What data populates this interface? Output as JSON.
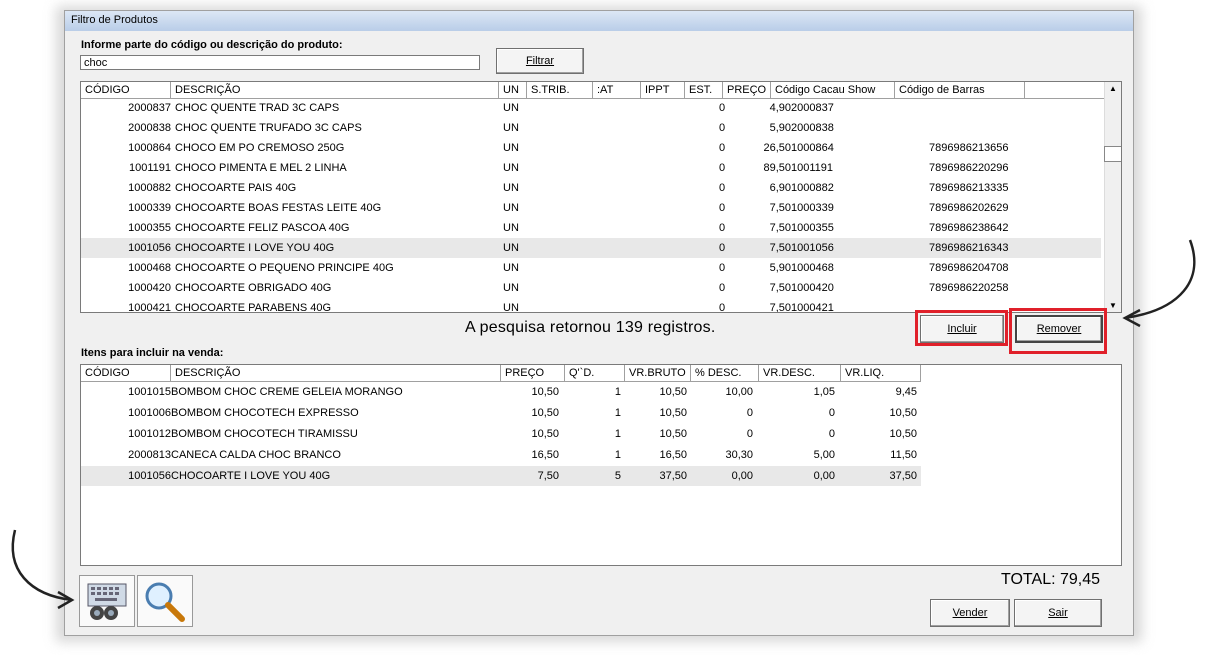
{
  "window": {
    "title": "Filtro de Produtos"
  },
  "search": {
    "prompt": "Informe parte do código ou descrição do produto:",
    "value": "choc",
    "filter_label": "Filtrar"
  },
  "products": {
    "columns": [
      "CÓDIGO",
      "DESCRIÇÃO",
      "UN",
      "S.TRIB.",
      ":AT",
      "IPPT",
      "EST.",
      "PREÇO",
      "Código Cacau Show",
      "Código de Barras"
    ],
    "rows": [
      {
        "code": "2000837",
        "desc": "CHOC QUENTE TRAD 3C CAPS",
        "un": "UN",
        "est": "0",
        "preco": "4,90",
        "cacau": "2000837",
        "barras": ""
      },
      {
        "code": "2000838",
        "desc": "CHOC QUENTE TRUFADO 3C CAPS",
        "un": "UN",
        "est": "0",
        "preco": "5,90",
        "cacau": "2000838",
        "barras": ""
      },
      {
        "code": "1000864",
        "desc": "CHOCO EM PO CREMOSO 250G",
        "un": "UN",
        "est": "0",
        "preco": "26,50",
        "cacau": "1000864",
        "barras": "7896986213656"
      },
      {
        "code": "1001191",
        "desc": "CHOCO PIMENTA E MEL 2 LINHA",
        "un": "UN",
        "est": "0",
        "preco": "89,50",
        "cacau": "1001191",
        "barras": "7896986220296"
      },
      {
        "code": "1000882",
        "desc": "CHOCOARTE  PAIS 40G",
        "un": "UN",
        "est": "0",
        "preco": "6,90",
        "cacau": "1000882",
        "barras": "7896986213335"
      },
      {
        "code": "1000339",
        "desc": "CHOCOARTE BOAS FESTAS LEITE 40G",
        "un": "UN",
        "est": "0",
        "preco": "7,50",
        "cacau": "1000339",
        "barras": "7896986202629"
      },
      {
        "code": "1000355",
        "desc": "CHOCOARTE FELIZ PASCOA 40G",
        "un": "UN",
        "est": "0",
        "preco": "7,50",
        "cacau": "1000355",
        "barras": "7896986238642"
      },
      {
        "code": "1001056",
        "desc": "CHOCOARTE I LOVE YOU 40G",
        "un": "UN",
        "est": "0",
        "preco": "7,50",
        "cacau": "1001056",
        "barras": "7896986216343"
      },
      {
        "code": "1000468",
        "desc": "CHOCOARTE O PEQUENO PRINCIPE 40G",
        "un": "UN",
        "est": "0",
        "preco": "5,90",
        "cacau": "1000468",
        "barras": "7896986204708"
      },
      {
        "code": "1000420",
        "desc": "CHOCOARTE OBRIGADO 40G",
        "un": "UN",
        "est": "0",
        "preco": "7,50",
        "cacau": "1000420",
        "barras": "7896986220258"
      },
      {
        "code": "1000421",
        "desc": "CHOCOARTE PARABENS 40G",
        "un": "UN",
        "est": "0",
        "preco": "7,50",
        "cacau": "1000421",
        "barras": ""
      }
    ],
    "selected_index": 7
  },
  "status_text": "A pesquisa retornou 139 registros.",
  "actions": {
    "incluir": "Incluir",
    "remover": "Remover"
  },
  "items": {
    "label": "Itens para incluir na venda:",
    "columns": [
      "CÓDIGO",
      "DESCRIÇÃO",
      "PREÇO",
      "Q'`D.",
      "VR.BRUTO",
      "% DESC.",
      "VR.DESC.",
      "VR.LIQ."
    ],
    "rows": [
      {
        "code": "1001015",
        "desc": "BOMBOM CHOC CREME GELEIA MORANGO",
        "preco": "10,50",
        "qtd": "1",
        "bruto": "10,50",
        "pdesc": "10,00",
        "vdesc": "1,05",
        "liq": "9,45"
      },
      {
        "code": "1001006",
        "desc": "BOMBOM CHOCOTECH EXPRESSO",
        "preco": "10,50",
        "qtd": "1",
        "bruto": "10,50",
        "pdesc": "0",
        "vdesc": "0",
        "liq": "10,50"
      },
      {
        "code": "1001012",
        "desc": "BOMBOM CHOCOTECH TIRAMISSU",
        "preco": "10,50",
        "qtd": "1",
        "bruto": "10,50",
        "pdesc": "0",
        "vdesc": "0",
        "liq": "10,50"
      },
      {
        "code": "2000813",
        "desc": "CANECA CALDA CHOC BRANCO",
        "preco": "16,50",
        "qtd": "1",
        "bruto": "16,50",
        "pdesc": "30,30",
        "vdesc": "5,00",
        "liq": "11,50"
      },
      {
        "code": "1001056",
        "desc": "CHOCOARTE I LOVE YOU 40G",
        "preco": "7,50",
        "qtd": "5",
        "bruto": "37,50",
        "pdesc": "0,00",
        "vdesc": "0,00",
        "liq": "37,50"
      }
    ],
    "selected_index": 4
  },
  "total_text": "TOTAL: 79,45",
  "footer": {
    "vender": "Vender",
    "sair": "Sair"
  },
  "colors": {
    "highlight_red": "#e0202a",
    "titlebar": "#b9cde8"
  }
}
